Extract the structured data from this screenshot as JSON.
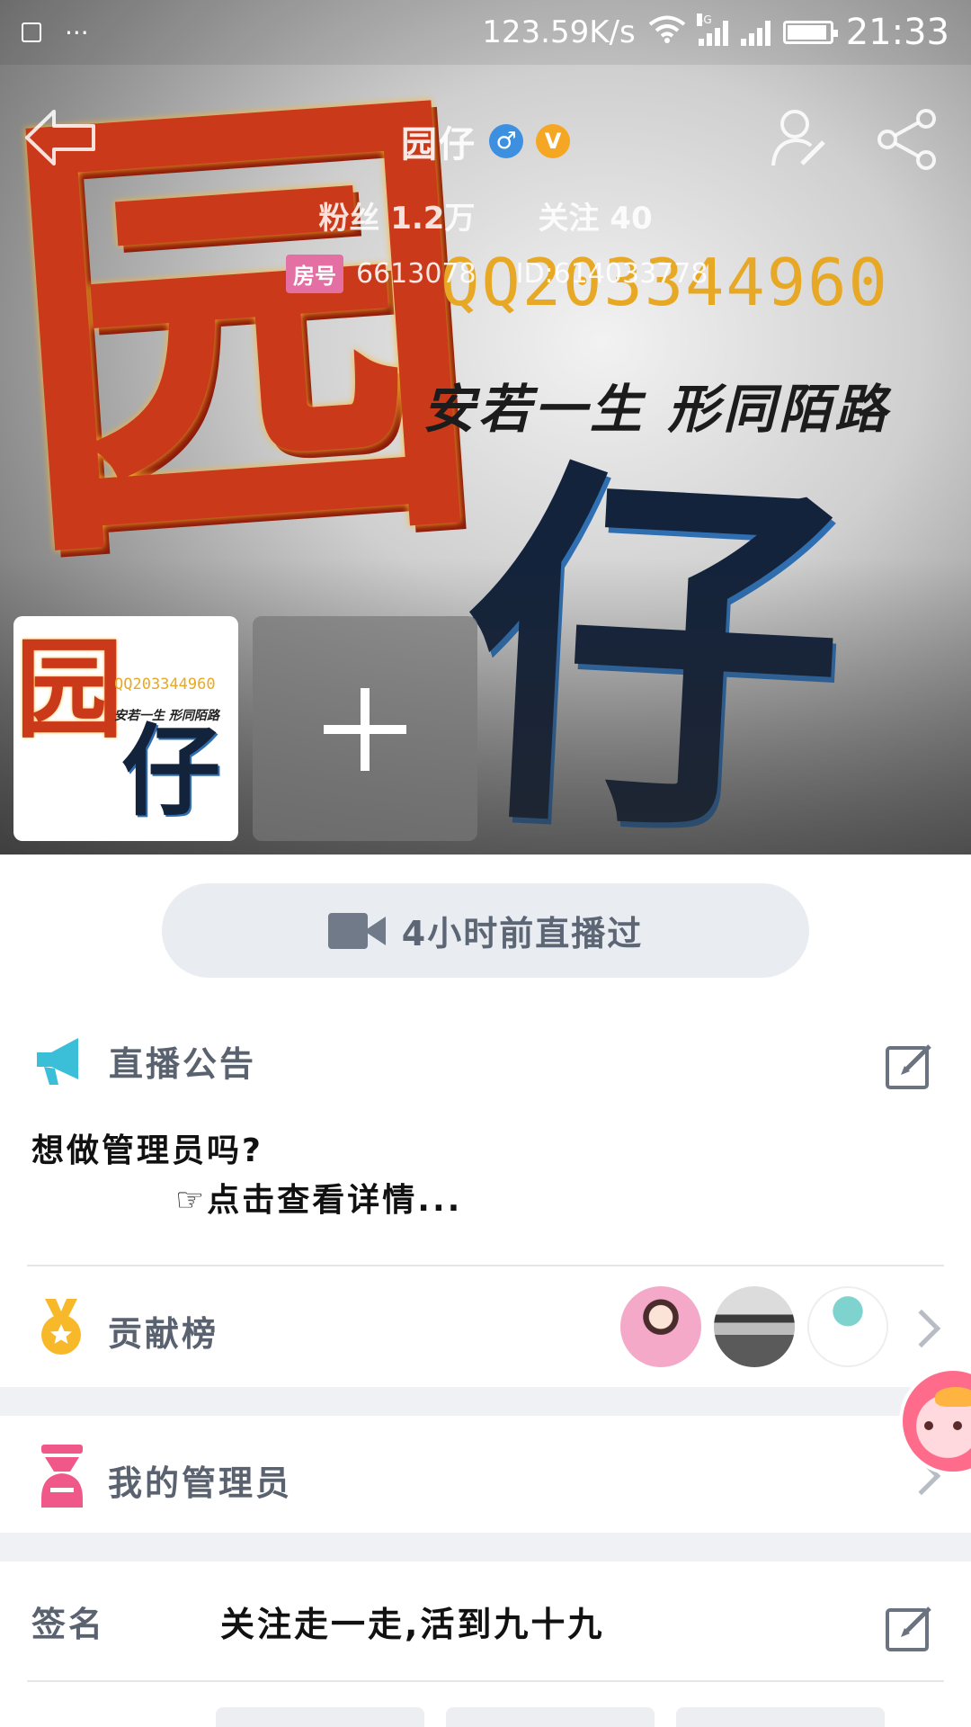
{
  "status_bar": {
    "network_speed": "123.59K/s",
    "network_type": "4G",
    "time": "21:33",
    "battery_level": 0.95
  },
  "profile": {
    "name": "园仔",
    "gender_symbol": "♂",
    "verified_symbol": "V",
    "fans_label": "粉丝",
    "fans_count": "1.2万",
    "follow_label": "关注",
    "follow_count": "40",
    "room_label": "房号",
    "room_number": "6613078",
    "user_id": "ID:614033778"
  },
  "cover": {
    "glyph_1": "园",
    "glyph_2": "仔",
    "qq_text": "QQ203344960",
    "motto": "安若一生 形同陌路"
  },
  "live": {
    "status_text": "4小时前直播过"
  },
  "announcement": {
    "title": "直播公告",
    "line1": "想做管理员吗?",
    "line2": "☞点击查看详情..."
  },
  "contribution": {
    "title": "贡献榜"
  },
  "admins": {
    "title": "我的管理员"
  },
  "signature": {
    "label": "签名",
    "text": "关注走一走,活到九十九"
  },
  "colors": {
    "accent_blue": "#3d8fe0",
    "verified_gold": "#f5a623",
    "megaphone": "#3bbfd8",
    "medal": "#f7b82a",
    "admin_pink": "#f0588a",
    "room_tag": "#e46fa3"
  },
  "icons": {
    "back": "back-arrow-icon",
    "edit_profile": "person-edit-icon",
    "share": "share-icon",
    "camera": "video-camera-icon",
    "megaphone": "megaphone-icon",
    "edit": "edit-square-icon",
    "medal": "medal-icon",
    "admin": "admin-person-icon",
    "chevron": "chevron-right-icon"
  }
}
